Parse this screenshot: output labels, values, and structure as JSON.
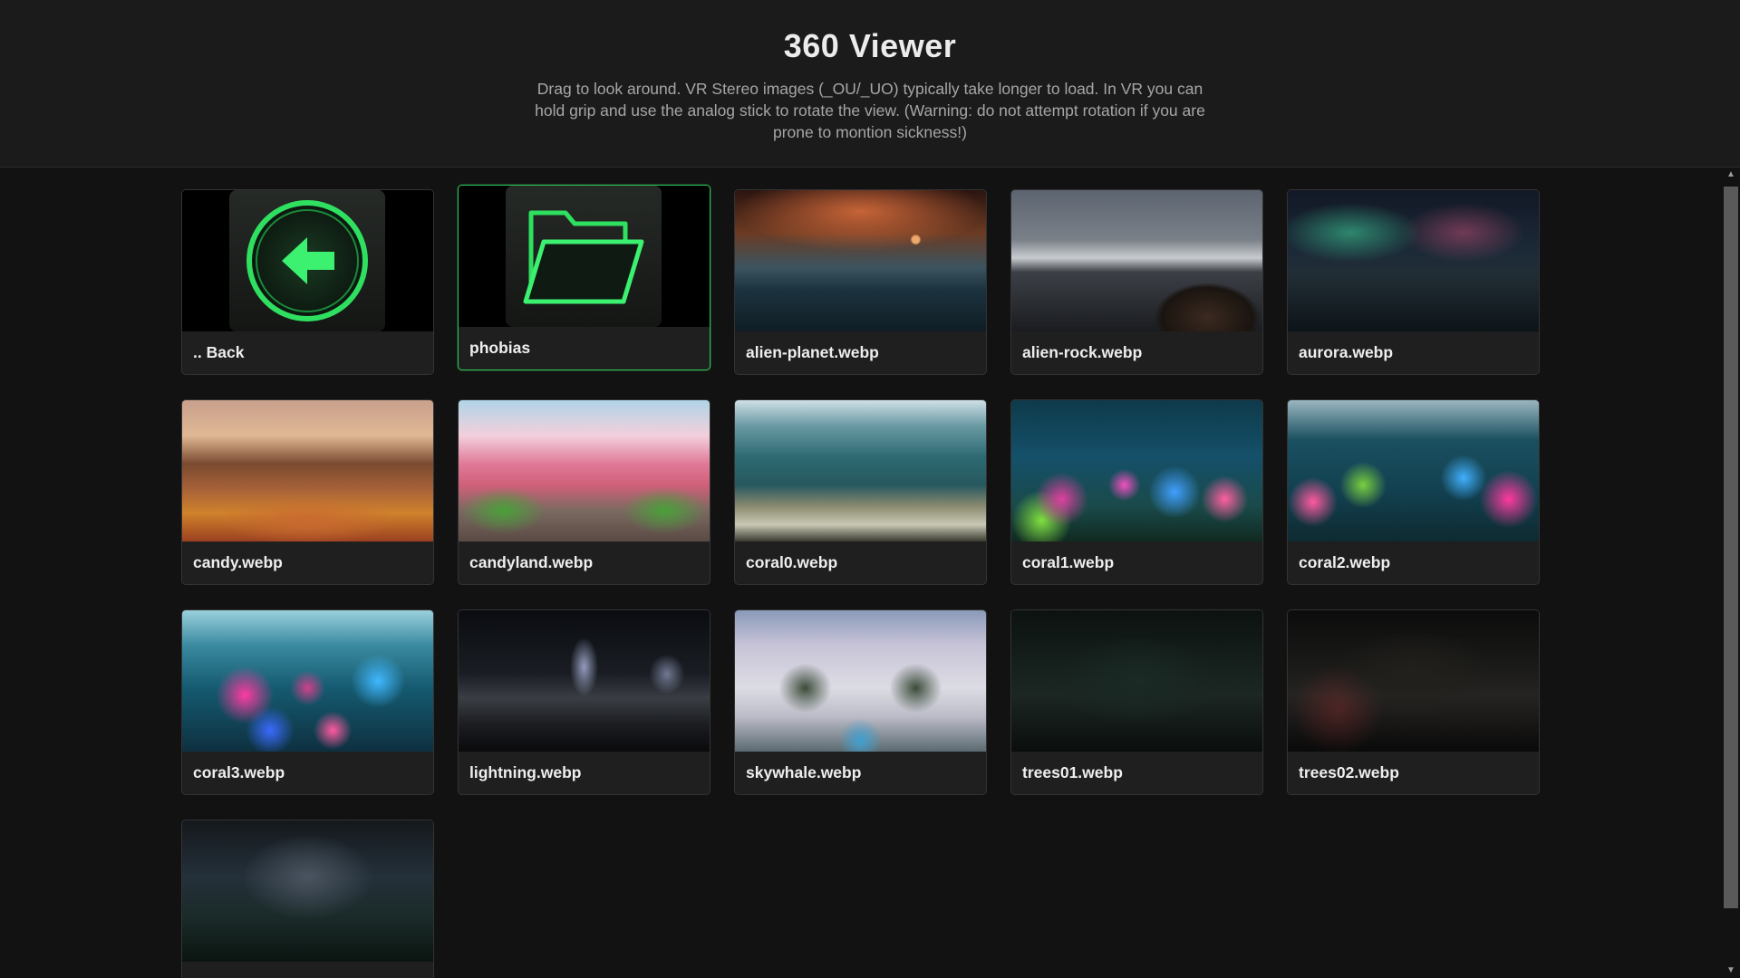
{
  "header": {
    "title": "360 Viewer",
    "description": "Drag to look around. VR Stereo images (_OU/_UO) typically take longer to load. In VR you can hold grip and use the analog stick to rotate the view. (Warning: do not attempt rotation if you are prone to montion sickness!)"
  },
  "colors": {
    "accent": "#2fbf55",
    "background": "#121212",
    "card": "#1f1f1f"
  },
  "items": [
    {
      "label": ".. Back",
      "type": "back",
      "icon": "arrow-left-circle-icon"
    },
    {
      "label": "phobias",
      "type": "folder",
      "icon": "folder-open-icon",
      "selected": true
    },
    {
      "label": "alien-planet.webp",
      "type": "image",
      "thumb": "alien-planet"
    },
    {
      "label": "alien-rock.webp",
      "type": "image",
      "thumb": "alien-rock"
    },
    {
      "label": "aurora.webp",
      "type": "image",
      "thumb": "aurora"
    },
    {
      "label": "candy.webp",
      "type": "image",
      "thumb": "candy"
    },
    {
      "label": "candyland.webp",
      "type": "image",
      "thumb": "candyland"
    },
    {
      "label": "coral0.webp",
      "type": "image",
      "thumb": "coral0"
    },
    {
      "label": "coral1.webp",
      "type": "image",
      "thumb": "coral1"
    },
    {
      "label": "coral2.webp",
      "type": "image",
      "thumb": "coral2"
    },
    {
      "label": "coral3.webp",
      "type": "image",
      "thumb": "coral3"
    },
    {
      "label": "lightning.webp",
      "type": "image",
      "thumb": "lightning"
    },
    {
      "label": "skywhale.webp",
      "type": "image",
      "thumb": "skywhale"
    },
    {
      "label": "trees01.webp",
      "type": "image",
      "thumb": "trees01"
    },
    {
      "label": "trees02.webp",
      "type": "image",
      "thumb": "trees02"
    },
    {
      "label": "",
      "type": "image",
      "thumb": "trees03"
    }
  ]
}
